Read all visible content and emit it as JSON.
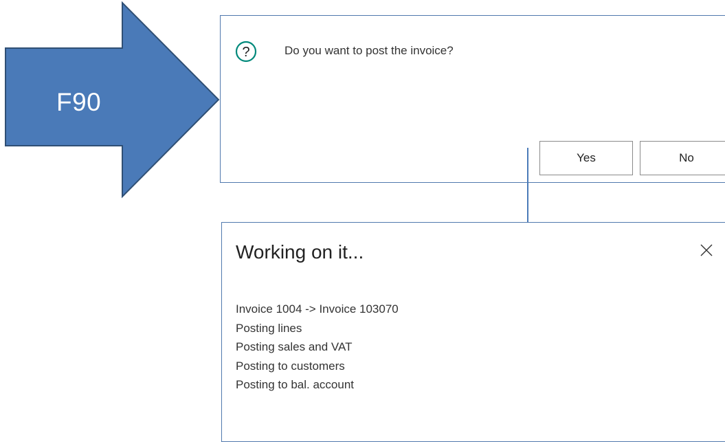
{
  "arrow": {
    "label": "F90",
    "fill_color": "#4a7ab8",
    "border_color": "#2f4f74"
  },
  "confirm_dialog": {
    "icon": "question-circle-icon",
    "message": "Do you want to post the invoice?",
    "yes_label": "Yes",
    "no_label": "No",
    "accent_color": "#00897b"
  },
  "progress_dialog": {
    "title": "Working on it...",
    "close_icon": "close-icon",
    "status_lines": [
      "Invoice 1004 -> Invoice 103070",
      "Posting lines",
      "Posting sales and VAT",
      "Posting to customers",
      "Posting to bal. account"
    ]
  }
}
